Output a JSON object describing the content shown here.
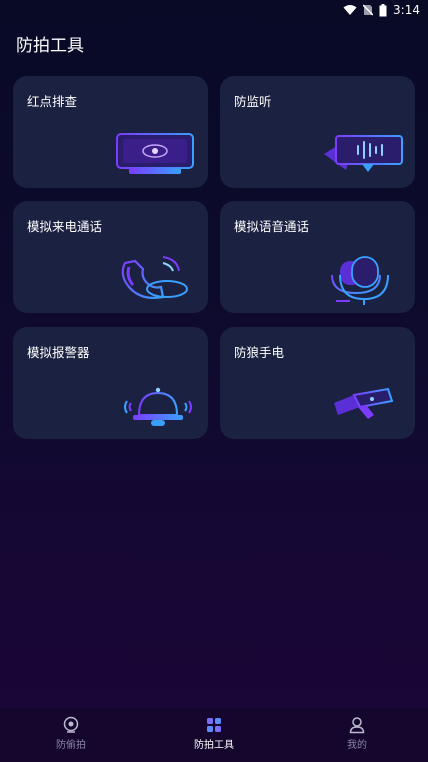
{
  "status_bar": {
    "time": "3:14"
  },
  "page": {
    "title": "防拍工具"
  },
  "cards": [
    {
      "label": "红点排查",
      "icon": "screen-eye-icon"
    },
    {
      "label": "防监听",
      "icon": "audio-wave-screen-icon"
    },
    {
      "label": "模拟来电通话",
      "icon": "phone-handset-icon"
    },
    {
      "label": "模拟语音通话",
      "icon": "microphone-icon"
    },
    {
      "label": "模拟报警器",
      "icon": "alarm-bell-icon"
    },
    {
      "label": "防狼手电",
      "icon": "flashlight-icon"
    }
  ],
  "bottom_nav": {
    "active": "防拍工具",
    "items": [
      {
        "label": "防偷拍",
        "icon": "camera-lens-icon"
      },
      {
        "label": "防拍工具",
        "icon": "grid-tools-icon"
      },
      {
        "label": "我的",
        "icon": "user-icon"
      }
    ]
  },
  "colors": {
    "accent_purple": "#7b3cff",
    "accent_blue": "#3aa0ff",
    "card_bg": "#1b2140"
  }
}
